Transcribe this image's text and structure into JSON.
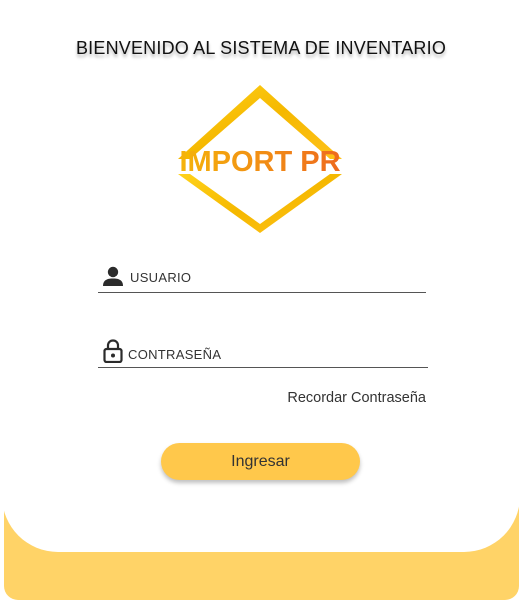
{
  "header": {
    "title": "BIENVENIDO AL SISTEMA DE INVENTARIO"
  },
  "logo": {
    "text": "IMPORT PR",
    "icon": "diamond-logo"
  },
  "form": {
    "username": {
      "placeholder": "USUARIO",
      "value": "",
      "icon": "user-icon"
    },
    "password": {
      "placeholder": "CONTRASEÑA",
      "value": "",
      "icon": "lock-icon"
    },
    "forgot_label": "Recordar Contraseña",
    "submit_label": "Ingresar"
  },
  "colors": {
    "accent": "#FFC84B",
    "panel": "#FFD367",
    "logo_gold": "#F5B800",
    "logo_orange": "#EE6A1E"
  }
}
